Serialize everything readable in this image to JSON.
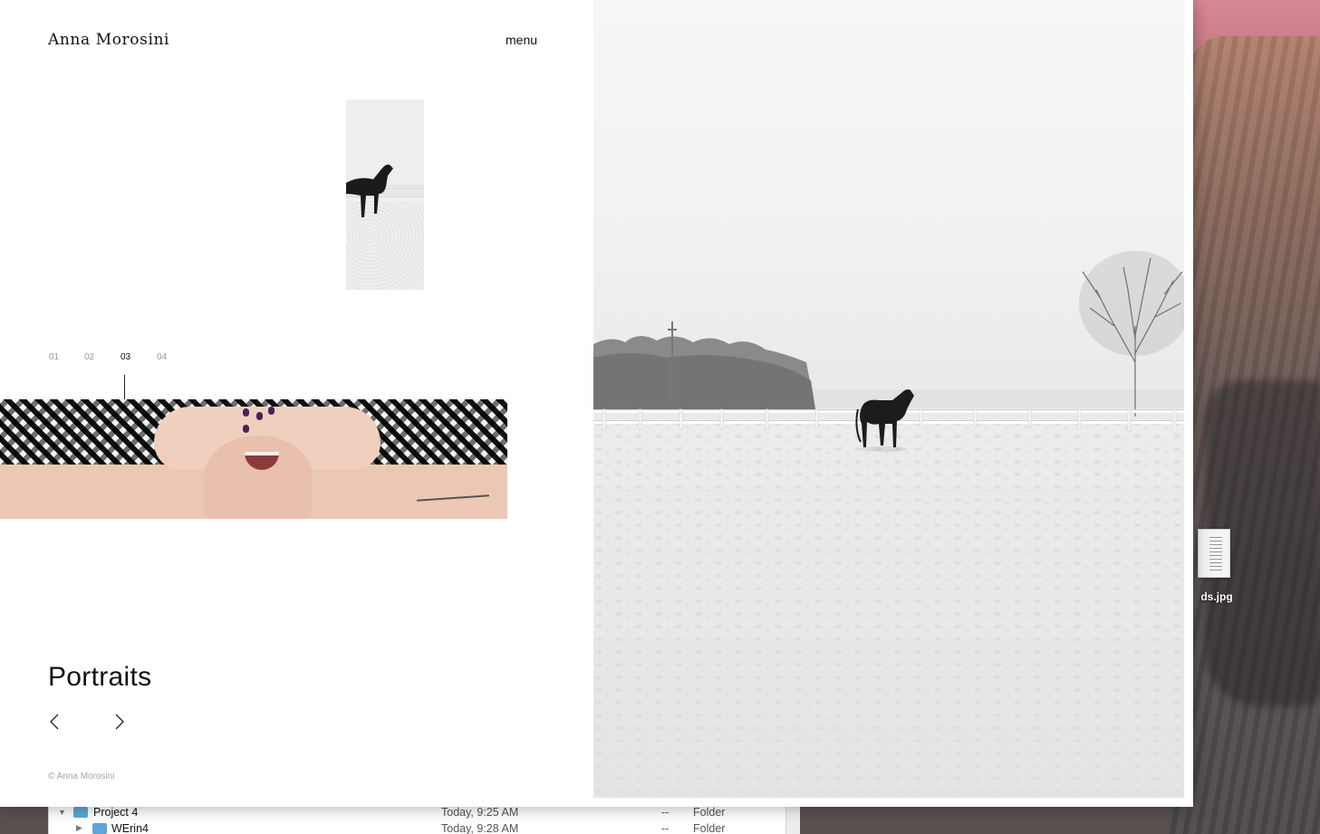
{
  "site": {
    "brand": "Anna Morosini",
    "menu_label": "menu"
  },
  "gallery": {
    "indices": [
      "01",
      "02",
      "03",
      "04"
    ],
    "active_index": "03",
    "section_title": "Portraits",
    "prev_icon": "chevron-left-icon",
    "next_icon": "chevron-right-icon"
  },
  "footer": {
    "copyright": "© Anna Morosini"
  },
  "desktop": {
    "file_label": "ds.jpg"
  },
  "finder": {
    "rows": [
      {
        "name": "Project 4",
        "date": "Today, 9:25 AM",
        "size": "--",
        "kind": "Folder",
        "expanded": true
      },
      {
        "name": "WErin4",
        "date": "Today, 9:28 AM",
        "size": "--",
        "kind": "Folder",
        "expanded": false
      }
    ]
  },
  "colors": {
    "text": "#111111",
    "muted": "#9a9a9a",
    "page_bg": "#ffffff"
  }
}
